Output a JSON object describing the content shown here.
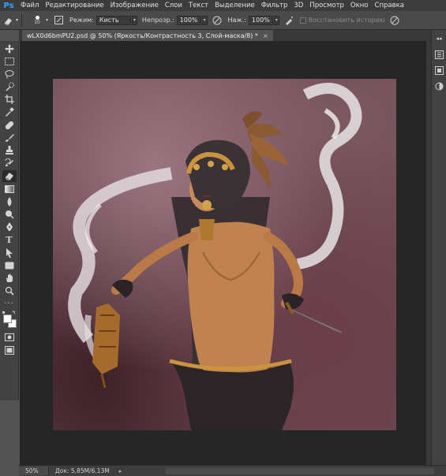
{
  "app": {
    "logo": "Ps"
  },
  "menu": [
    "Файл",
    "Редактирование",
    "Изображение",
    "Слои",
    "Текст",
    "Выделение",
    "Фильтр",
    "3D",
    "Просмотр",
    "Окно",
    "Справка"
  ],
  "options": {
    "brush_size": "10",
    "mode_label": "Режим:",
    "mode_value": "Кисть",
    "opacity_label": "Непрозр.:",
    "opacity_value": "100%",
    "pressure_label": "Наж.:",
    "pressure_value": "100%",
    "restore_history": "Восстановить историю"
  },
  "document": {
    "tab_title": "wLX0d6bmPU2.psd @ 50% (Яркость/Контрастность 3, Слой-маска/8) *",
    "close": "×"
  },
  "status": {
    "zoom": "50%",
    "doc_size": "Док: 5,85M/6,13M",
    "arrow": "▸"
  },
  "colors": {
    "accent": "#31a8ff",
    "foreground": "#ffffff",
    "background": "#ffffff"
  },
  "tools": [
    "move-icon",
    "marquee-icon",
    "lasso-icon",
    "quick-select-icon",
    "crop-icon",
    "eyedropper-icon",
    "healing-brush-icon",
    "brush-icon",
    "clone-stamp-icon",
    "history-brush-icon",
    "eraser-icon",
    "gradient-icon",
    "blur-icon",
    "dodge-icon",
    "pen-icon",
    "type-icon",
    "path-select-icon",
    "shape-icon",
    "hand-icon",
    "zoom-icon"
  ]
}
